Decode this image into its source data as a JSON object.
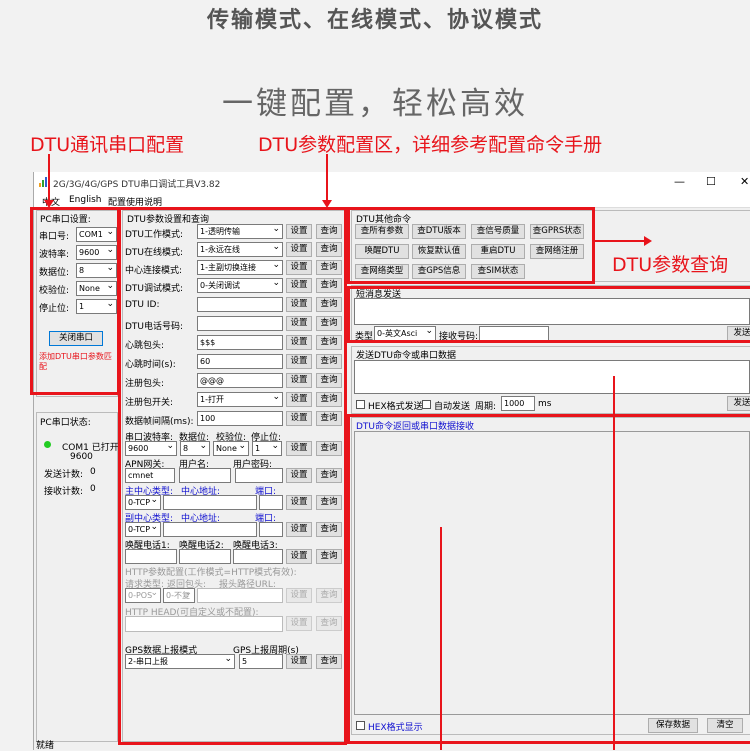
{
  "headline": "传输模式、在线模式、协议模式",
  "subheadline": "一键配置，轻松高效",
  "annotations": {
    "serial": "DTU通讯串口配置",
    "params": "DTU参数配置区，详细参考配置命令手册",
    "query": "DTU参数查询"
  },
  "window": {
    "title": "2G/3G/4G/GPS DTU串口调试工具V3.82",
    "menu": [
      "中文",
      "English",
      "配置使用说明"
    ],
    "controls": {
      "min": "—",
      "max": "☐",
      "close": "✕"
    }
  },
  "pc_settings": {
    "title": "PC串口设置:",
    "port_label": "串口号:",
    "port_value": "COM1",
    "baud_label": "波特率:",
    "baud_value": "9600",
    "data_label": "数据位:",
    "data_value": "8",
    "parity_label": "校验位:",
    "parity_value": "None",
    "stop_label": "停止位:",
    "stop_value": "1",
    "close_button": "关闭串口",
    "note": "添加DTU串口参数匹配"
  },
  "pc_status": {
    "title": "PC串口状态:",
    "port_status": "COM1 已打开",
    "baud": "9600",
    "send_label": "发送计数:",
    "send_value": "0",
    "recv_label": "接收计数:",
    "recv_value": "0"
  },
  "dtu_params": {
    "title": "DTU参数设置和查询",
    "set_label": "设置",
    "query_label": "查询",
    "rows": [
      {
        "label": "DTU工作模式:",
        "value": "1-透明传输",
        "type": "select"
      },
      {
        "label": "DTU在线模式:",
        "value": "1-永远在线",
        "type": "select"
      },
      {
        "label": "中心连接模式:",
        "value": "1-主副切换连接",
        "type": "select"
      },
      {
        "label": "DTU调试模式:",
        "value": "0-关闭调试",
        "type": "select"
      },
      {
        "label": "DTU ID:",
        "value": "",
        "type": "input"
      },
      {
        "label": "DTU电话号码:",
        "value": "",
        "type": "input"
      },
      {
        "label": "心跳包头:",
        "value": "$$$",
        "type": "input"
      },
      {
        "label": "心跳时间(s):",
        "value": "60",
        "type": "input"
      },
      {
        "label": "注册包头:",
        "value": "@@@",
        "type": "input"
      },
      {
        "label": "注册包开关:",
        "value": "1-打开",
        "type": "select"
      },
      {
        "label": "数据帧间隔(ms):",
        "value": "100",
        "type": "input"
      }
    ],
    "serial_header": {
      "baud": "串口波特率:",
      "data": "数据位:",
      "parity": "校验位:",
      "stop": "停止位:"
    },
    "serial_values": {
      "baud": "9600",
      "data": "8",
      "parity": "None",
      "stop": "1"
    },
    "apn_header": {
      "apn": "APN网关:",
      "user": "用户名:",
      "pass": "用户密码:"
    },
    "apn_value": "cmnet",
    "main_center": {
      "type": "主中心类型:",
      "addr": "中心地址:",
      "port": "端口:",
      "value": "0-TCP"
    },
    "sub_center": {
      "type": "副中心类型:",
      "addr": "中心地址:",
      "port": "端口:",
      "value": "0-TCP"
    },
    "wake": {
      "p1": "唤醒电话1:",
      "p2": "唤醒电话2:",
      "p3": "唤醒电话3:"
    },
    "http": {
      "title": "HTTP参数配置(工作模式=HTTP模式有效):",
      "req_type": "请求类型:",
      "ret_head": "返回包头:",
      "path": "报头路径URL:",
      "req_value": "0-POS",
      "ret_value": "0-不复",
      "head": "HTTP HEAD(可自定义或不配置):"
    },
    "gps": {
      "mode_label": "GPS数据上报模式",
      "period_label": "GPS上报周期(s)",
      "mode_value": "2-串口上报",
      "period_value": "5"
    }
  },
  "dtu_other": {
    "title": "DTU其他命令",
    "buttons": [
      [
        "查所有参数",
        "查DTU版本",
        "查信号质量",
        "查GPRS状态"
      ],
      [
        "唤醒DTU",
        "恢复默认值",
        "重启DTU",
        "查网络注册"
      ],
      [
        "查网络类型",
        "查GPS信息",
        "查SIM状态"
      ]
    ]
  },
  "short_msg": {
    "title": "短消息发送",
    "type_label": "类型",
    "type_value": "0-英文Asci",
    "recv_label": "接收号码:",
    "send": "发送"
  },
  "send_area": {
    "title": "发送DTU命令或串口数据",
    "hex_label": "HEX格式发送",
    "auto_label": "自动发送",
    "period_label": "周期:",
    "period_value": "1000",
    "unit": "ms",
    "send": "发送"
  },
  "receive_area": {
    "title": "DTU命令返回或串口数据接收",
    "hex_label": "HEX格式显示",
    "save": "保存数据",
    "clear": "清空"
  },
  "status_bar": "就绪"
}
